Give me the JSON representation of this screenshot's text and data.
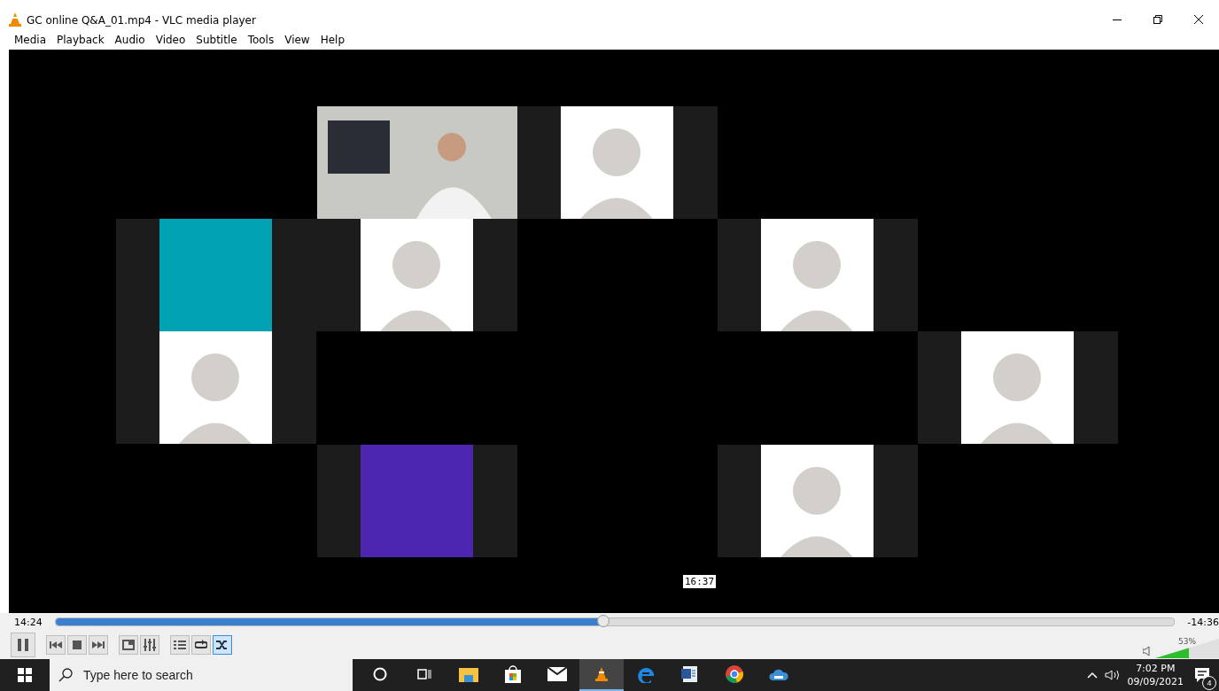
{
  "window": {
    "title": "GC online Q&A_01.mp4 - VLC media player"
  },
  "menu": [
    "Media",
    "Playback",
    "Audio",
    "Video",
    "Subtitle",
    "Tools",
    "View",
    "Help"
  ],
  "video": {
    "kind": "picture",
    "hover_time": "16:37"
  },
  "seek": {
    "elapsed": "14:24",
    "remaining": "-14:36",
    "level": 0.49
  },
  "controls": [
    {
      "kind": "pause",
      "on": false
    },
    {
      "kind": "prev",
      "on": false
    },
    {
      "kind": "stop",
      "on": false
    },
    {
      "kind": "next",
      "on": false
    },
    {
      "kind": "frame",
      "on": false
    },
    {
      "kind": "settings",
      "on": false
    },
    {
      "kind": "playlist",
      "on": false
    },
    {
      "kind": "loop",
      "on": false
    },
    {
      "kind": "shuffle",
      "on": true
    }
  ],
  "volume": {
    "reading": "53%",
    "level": 0.53
  },
  "taskbar": {
    "search": {
      "placeholder": "Type here to search"
    },
    "apps": [
      {
        "kind": "cortana",
        "selected": false
      },
      {
        "kind": "taskview",
        "selected": false
      },
      {
        "kind": "folder",
        "selected": false
      },
      {
        "kind": "store",
        "selected": false
      },
      {
        "kind": "mail",
        "selected": false
      },
      {
        "kind": "vlc",
        "selected": true
      },
      {
        "kind": "edge",
        "selected": false
      },
      {
        "kind": "word",
        "selected": false
      },
      {
        "kind": "chrome",
        "selected": false
      },
      {
        "kind": "cloud",
        "selected": false
      }
    ],
    "time": "7:02 PM",
    "date": "09/09/2021",
    "notifications": "4"
  }
}
